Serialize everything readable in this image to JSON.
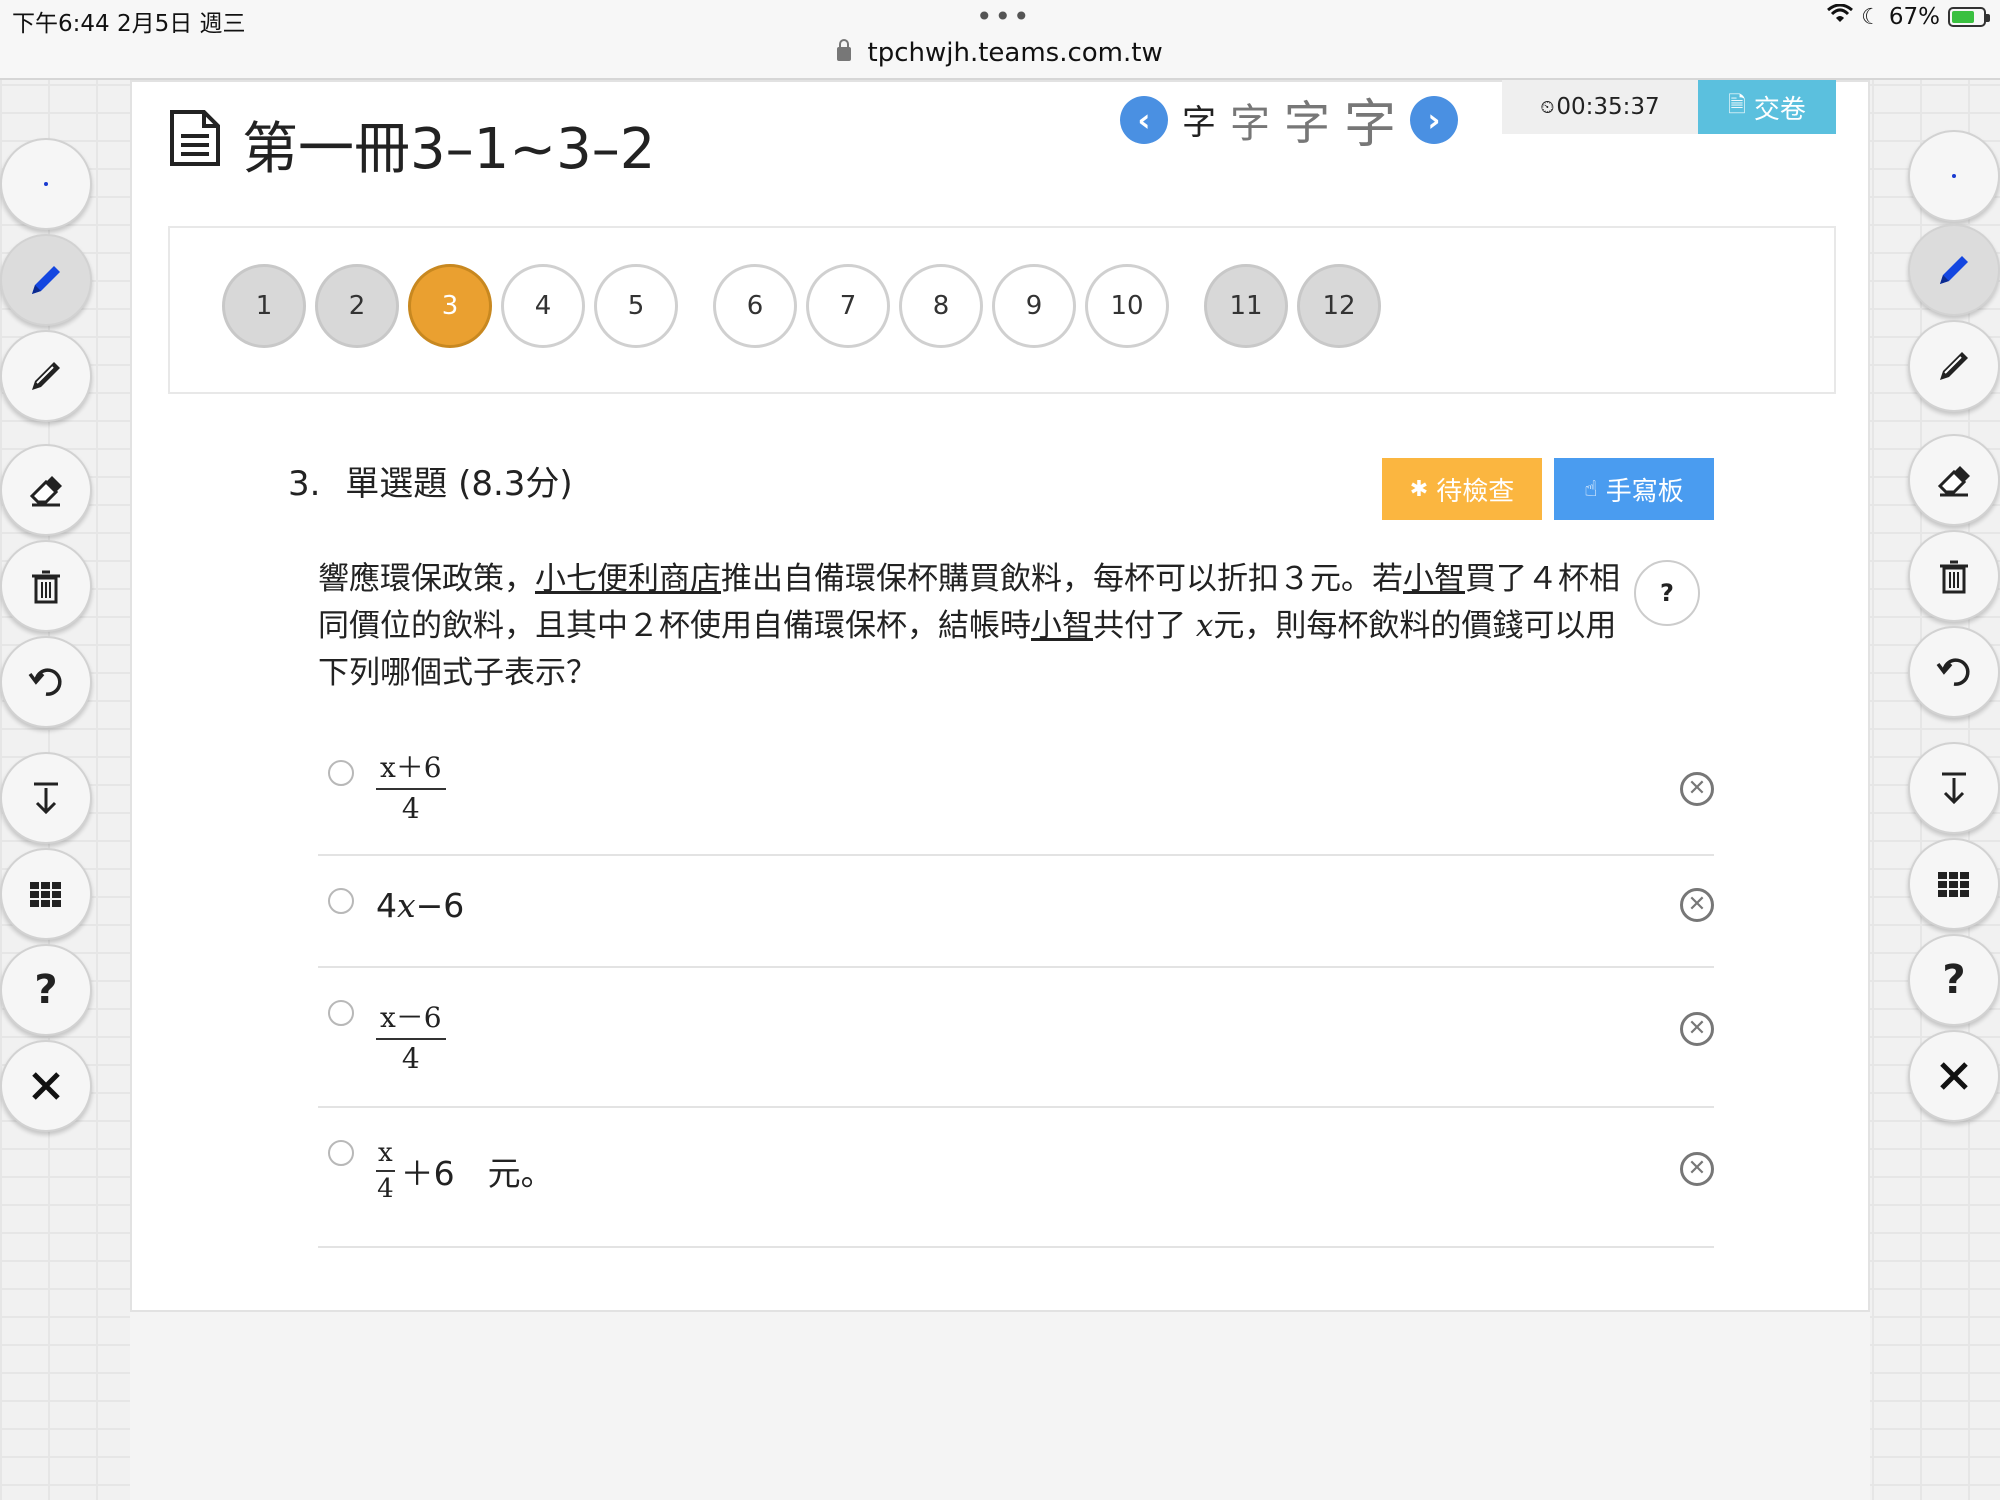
{
  "status": {
    "time": "下午6:44   2月5日 週三",
    "dots": "•••",
    "battery": "67%"
  },
  "url": "tpchwjh.teams.com.tw",
  "header": {
    "title": "第一冊3–1~3–2",
    "font_glyph": "字",
    "timer": "00:35:37",
    "submit_label": "交卷"
  },
  "question_nav": {
    "items": [
      "1",
      "2",
      "3",
      "4",
      "5",
      "6",
      "7",
      "8",
      "9",
      "10",
      "11",
      "12"
    ],
    "current": "3"
  },
  "question": {
    "number": "3.",
    "type": "單選題 (8.3分)",
    "pending_label": "待檢查",
    "handwrite_label": "手寫板",
    "help": "?",
    "text_1": "響應環保政策，",
    "text_store": "小七便利商店",
    "text_2": "推出自備環保杯購買飲料，每杯可以折扣３元。若",
    "text_name1": "小智",
    "text_3": "買了４杯相同價位的飲料，且其中２杯使用自備環保杯，結帳時",
    "text_name2": "小智",
    "text_4": "共付了",
    "text_var": "x",
    "text_5": "元，則每杯飲料的價錢可以用下列哪個式子表示？"
  },
  "options": {
    "a_num": "x＋6",
    "a_den": "4",
    "b_expr_pre": "4",
    "b_expr_var": "x",
    "b_expr_post": "−6",
    "c_num": "x－6",
    "c_den": "4",
    "d_num": "x",
    "d_den": "4",
    "d_post": "＋6　元。",
    "eliminate": "✕"
  },
  "toolbar": {
    "tools": [
      "dot-tool",
      "pen-blue",
      "pen-black",
      "eraser",
      "trash",
      "undo",
      "scroll-down",
      "grid",
      "help",
      "close"
    ],
    "help_label": "?"
  }
}
